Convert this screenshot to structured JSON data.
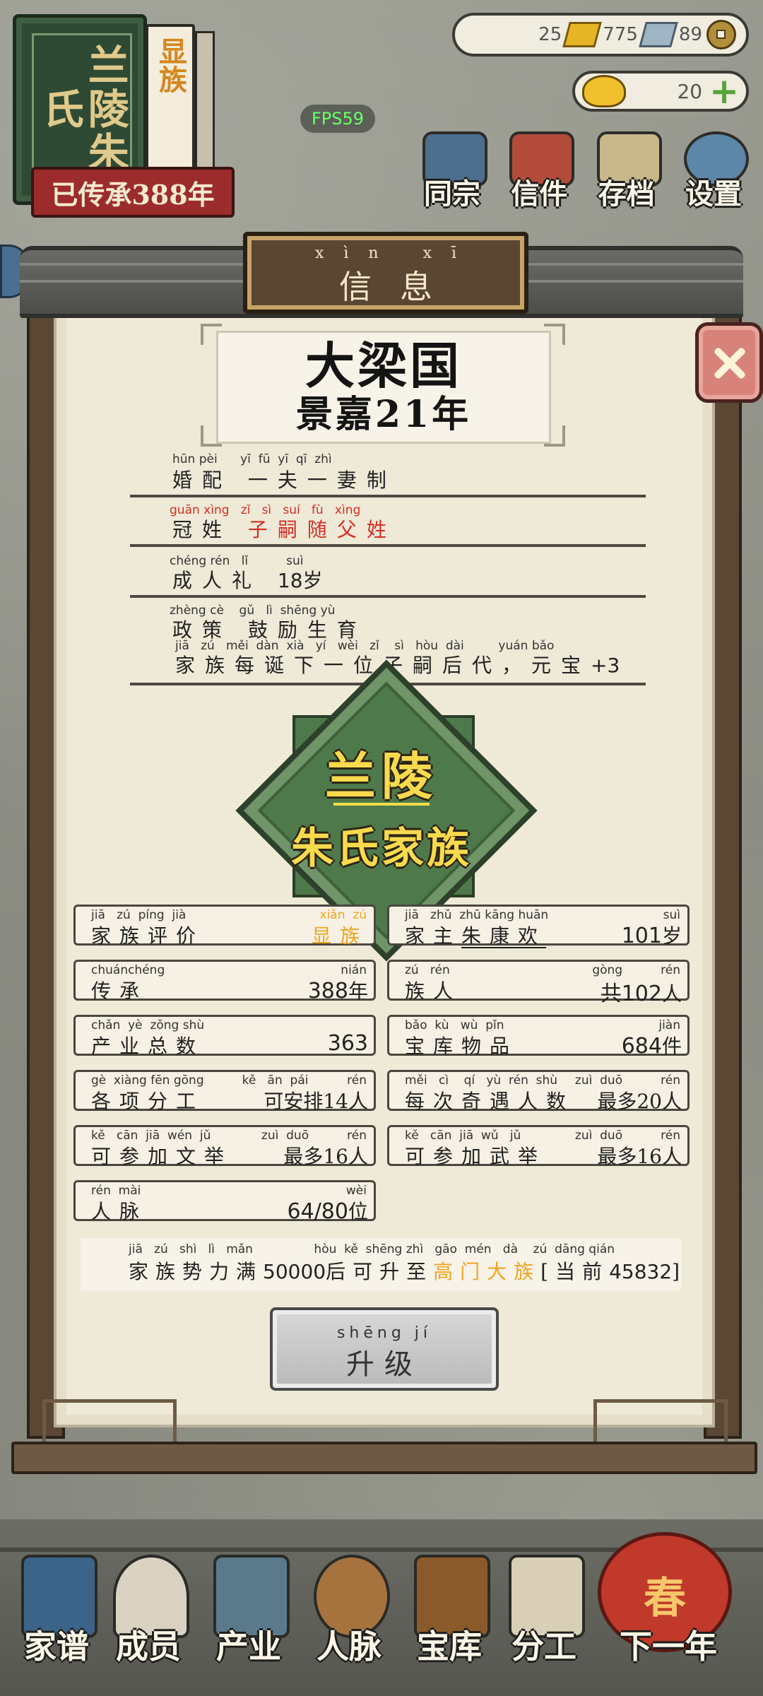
{
  "header": {
    "book_cover": "兰陵朱氏",
    "book_label": "显族",
    "inherit_text": "已传承388年",
    "fps": "FPS59",
    "resources": {
      "gold": "25",
      "silver": "775",
      "coin": "89",
      "yuanbao": "20"
    },
    "top_nav": [
      {
        "label": "同宗",
        "color": "#4d6f8f"
      },
      {
        "label": "信件",
        "color": "#b34b3b"
      },
      {
        "label": "存档",
        "color": "#c9b88c"
      },
      {
        "label": "设置",
        "color": "#5d87a8"
      }
    ]
  },
  "modal": {
    "title_py": "xìn xī",
    "title": "信息",
    "state_line1": "大梁国",
    "state_line2": "景嘉21年",
    "rules": [
      {
        "py": "hūn pèi      yī  fū  yī  qī  zhì",
        "text": "婚配 一夫一妻制"
      },
      {
        "py": "guān xìng   zǐ   sì   suí   fù   xìng",
        "text_a": "冠姓 ",
        "text_b": "子嗣随父姓"
      },
      {
        "py": "chéng rén   lǐ          suì",
        "text_a": "成人礼 ",
        "num": "18",
        "text_b": "岁"
      },
      {
        "py": "zhèng cè    gǔ   lì  shēng yù",
        "text": "政策 鼓励生育"
      },
      {
        "py": "jiā   zú   měi  dàn  xià   yí   wèi   zǐ    sì   hòu  dài         yuán bǎo",
        "text": "家族每诞下一位子嗣后代，元宝",
        "num": "+3"
      }
    ],
    "emblem_top": "兰陵",
    "emblem_bottom": "朱氏家族",
    "left_boxes": [
      {
        "py_l": "jiā   zú  píng  jià",
        "label": "家族评价",
        "py_r": "xiǎn  zú",
        "value": "显族",
        "orange": true
      },
      {
        "py_l": "chuánchéng",
        "label": "传承",
        "py_r": "nián",
        "value": "388",
        "unit": "年"
      },
      {
        "py_l": "chǎn  yè  zǒng shù",
        "label": "产业总数",
        "py_r": "",
        "value": "363",
        "unit": ""
      },
      {
        "py_l": "gè  xiàng fēn gōng          kě   ān  pái",
        "label": "各项分工",
        "py_r": "rén",
        "value": "可安排14",
        "unit": "人"
      },
      {
        "py_l": "kě   cān  jiā  wén  jǔ",
        "label": "可参加文举",
        "py_r": "zuì  duō          rén",
        "value": "最多16",
        "unit": "人"
      },
      {
        "py_l": "rén  mài",
        "label": "人脉",
        "py_r": "wèi",
        "value": "64/80",
        "unit": "位"
      }
    ],
    "right_boxes": [
      {
        "py_l": "jiā   zhǔ  zhū kāng huān",
        "label": "家主",
        "name": "朱康欢",
        "py_r": "suì",
        "value": "101",
        "unit": "岁"
      },
      {
        "py_l": "zú   rén",
        "label": "族人",
        "py_r": "gòng          rén",
        "value": "共102",
        "unit": "人"
      },
      {
        "py_l": "bǎo  kù   wù  pǐn",
        "label": "宝库物品",
        "py_r": "jiàn",
        "value": "684",
        "unit": "件"
      },
      {
        "py_l": "měi   cì    qí   yù  rén  shù",
        "label": "每次奇遇人数",
        "py_r": "zuì  duō          rén",
        "value": "最多20",
        "unit": "人"
      },
      {
        "py_l": "kě   cān  jiā  wǔ   jǔ",
        "label": "可参加武举",
        "py_r": "zuì  duō          rén",
        "value": "最多16",
        "unit": "人"
      }
    ],
    "progress": {
      "py": "jiā   zú   shì   lì   mǎn                hòu  kě  shēng zhì   gāo  mén   dà    zú  dāng qián",
      "text_a": "家族势力满",
      "threshold": "50000",
      "text_b": "后可升至",
      "target": "高门大族",
      "text_c": "[当前",
      "current": "45832",
      "text_d": "]"
    },
    "upgrade_py": "shēng jí",
    "upgrade_label": "升级"
  },
  "bottom_nav": [
    {
      "label": "家谱",
      "color": "#3c6489"
    },
    {
      "label": "成员",
      "color": "#d9d2c2"
    },
    {
      "label": "产业",
      "color": "#5a7a8c"
    },
    {
      "label": "人脉",
      "color": "#a6733e"
    },
    {
      "label": "宝库",
      "color": "#8b5a2b"
    },
    {
      "label": "分工",
      "color": "#d9cfb6"
    },
    {
      "label": "下一年",
      "color": "#c0392b"
    }
  ],
  "lantern_char": "春"
}
